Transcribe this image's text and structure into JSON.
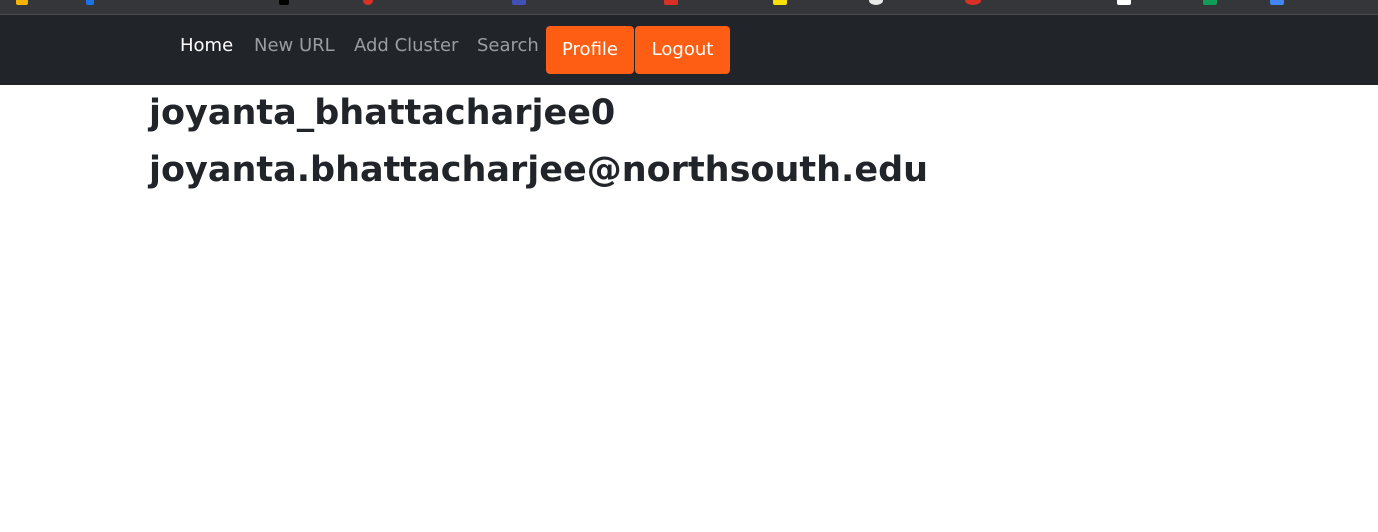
{
  "bookmarks_bar": {
    "icons": [
      {
        "name": "bookmark-apps-icon",
        "color": "#f4b400"
      },
      {
        "name": "bookmark-icon-2",
        "color": "#1a73e8"
      },
      {
        "name": "bookmark-icon-3",
        "color": "#000000"
      },
      {
        "name": "bookmark-icon-4",
        "color": "#d93025"
      },
      {
        "name": "bookmark-icon-5",
        "color": "#3f51b5"
      },
      {
        "name": "bookmark-icon-6",
        "color": "#d93025"
      },
      {
        "name": "bookmark-icon-7",
        "color": "#f9e000"
      },
      {
        "name": "bookmark-icon-8",
        "color": "#e8e8e8"
      },
      {
        "name": "bookmark-icon-9",
        "color": "#d93025"
      },
      {
        "name": "bookmark-icon-10",
        "color": "#ffffff"
      },
      {
        "name": "bookmark-icon-11",
        "color": "#0f9d58"
      },
      {
        "name": "bookmark-icon-12",
        "color": "#4285f4"
      }
    ]
  },
  "navbar": {
    "background": "#212529",
    "links": [
      {
        "label": "Home",
        "active": true
      },
      {
        "label": "New URL",
        "active": false
      },
      {
        "label": "Add Cluster",
        "active": false
      },
      {
        "label": "Search",
        "active": false
      }
    ],
    "profile_label": "Profile",
    "logout_label": "Logout",
    "button_color": "#fd5e14"
  },
  "profile": {
    "username": "joyanta_bhattacharjee0",
    "email": "joyanta.bhattacharjee@northsouth.edu"
  }
}
